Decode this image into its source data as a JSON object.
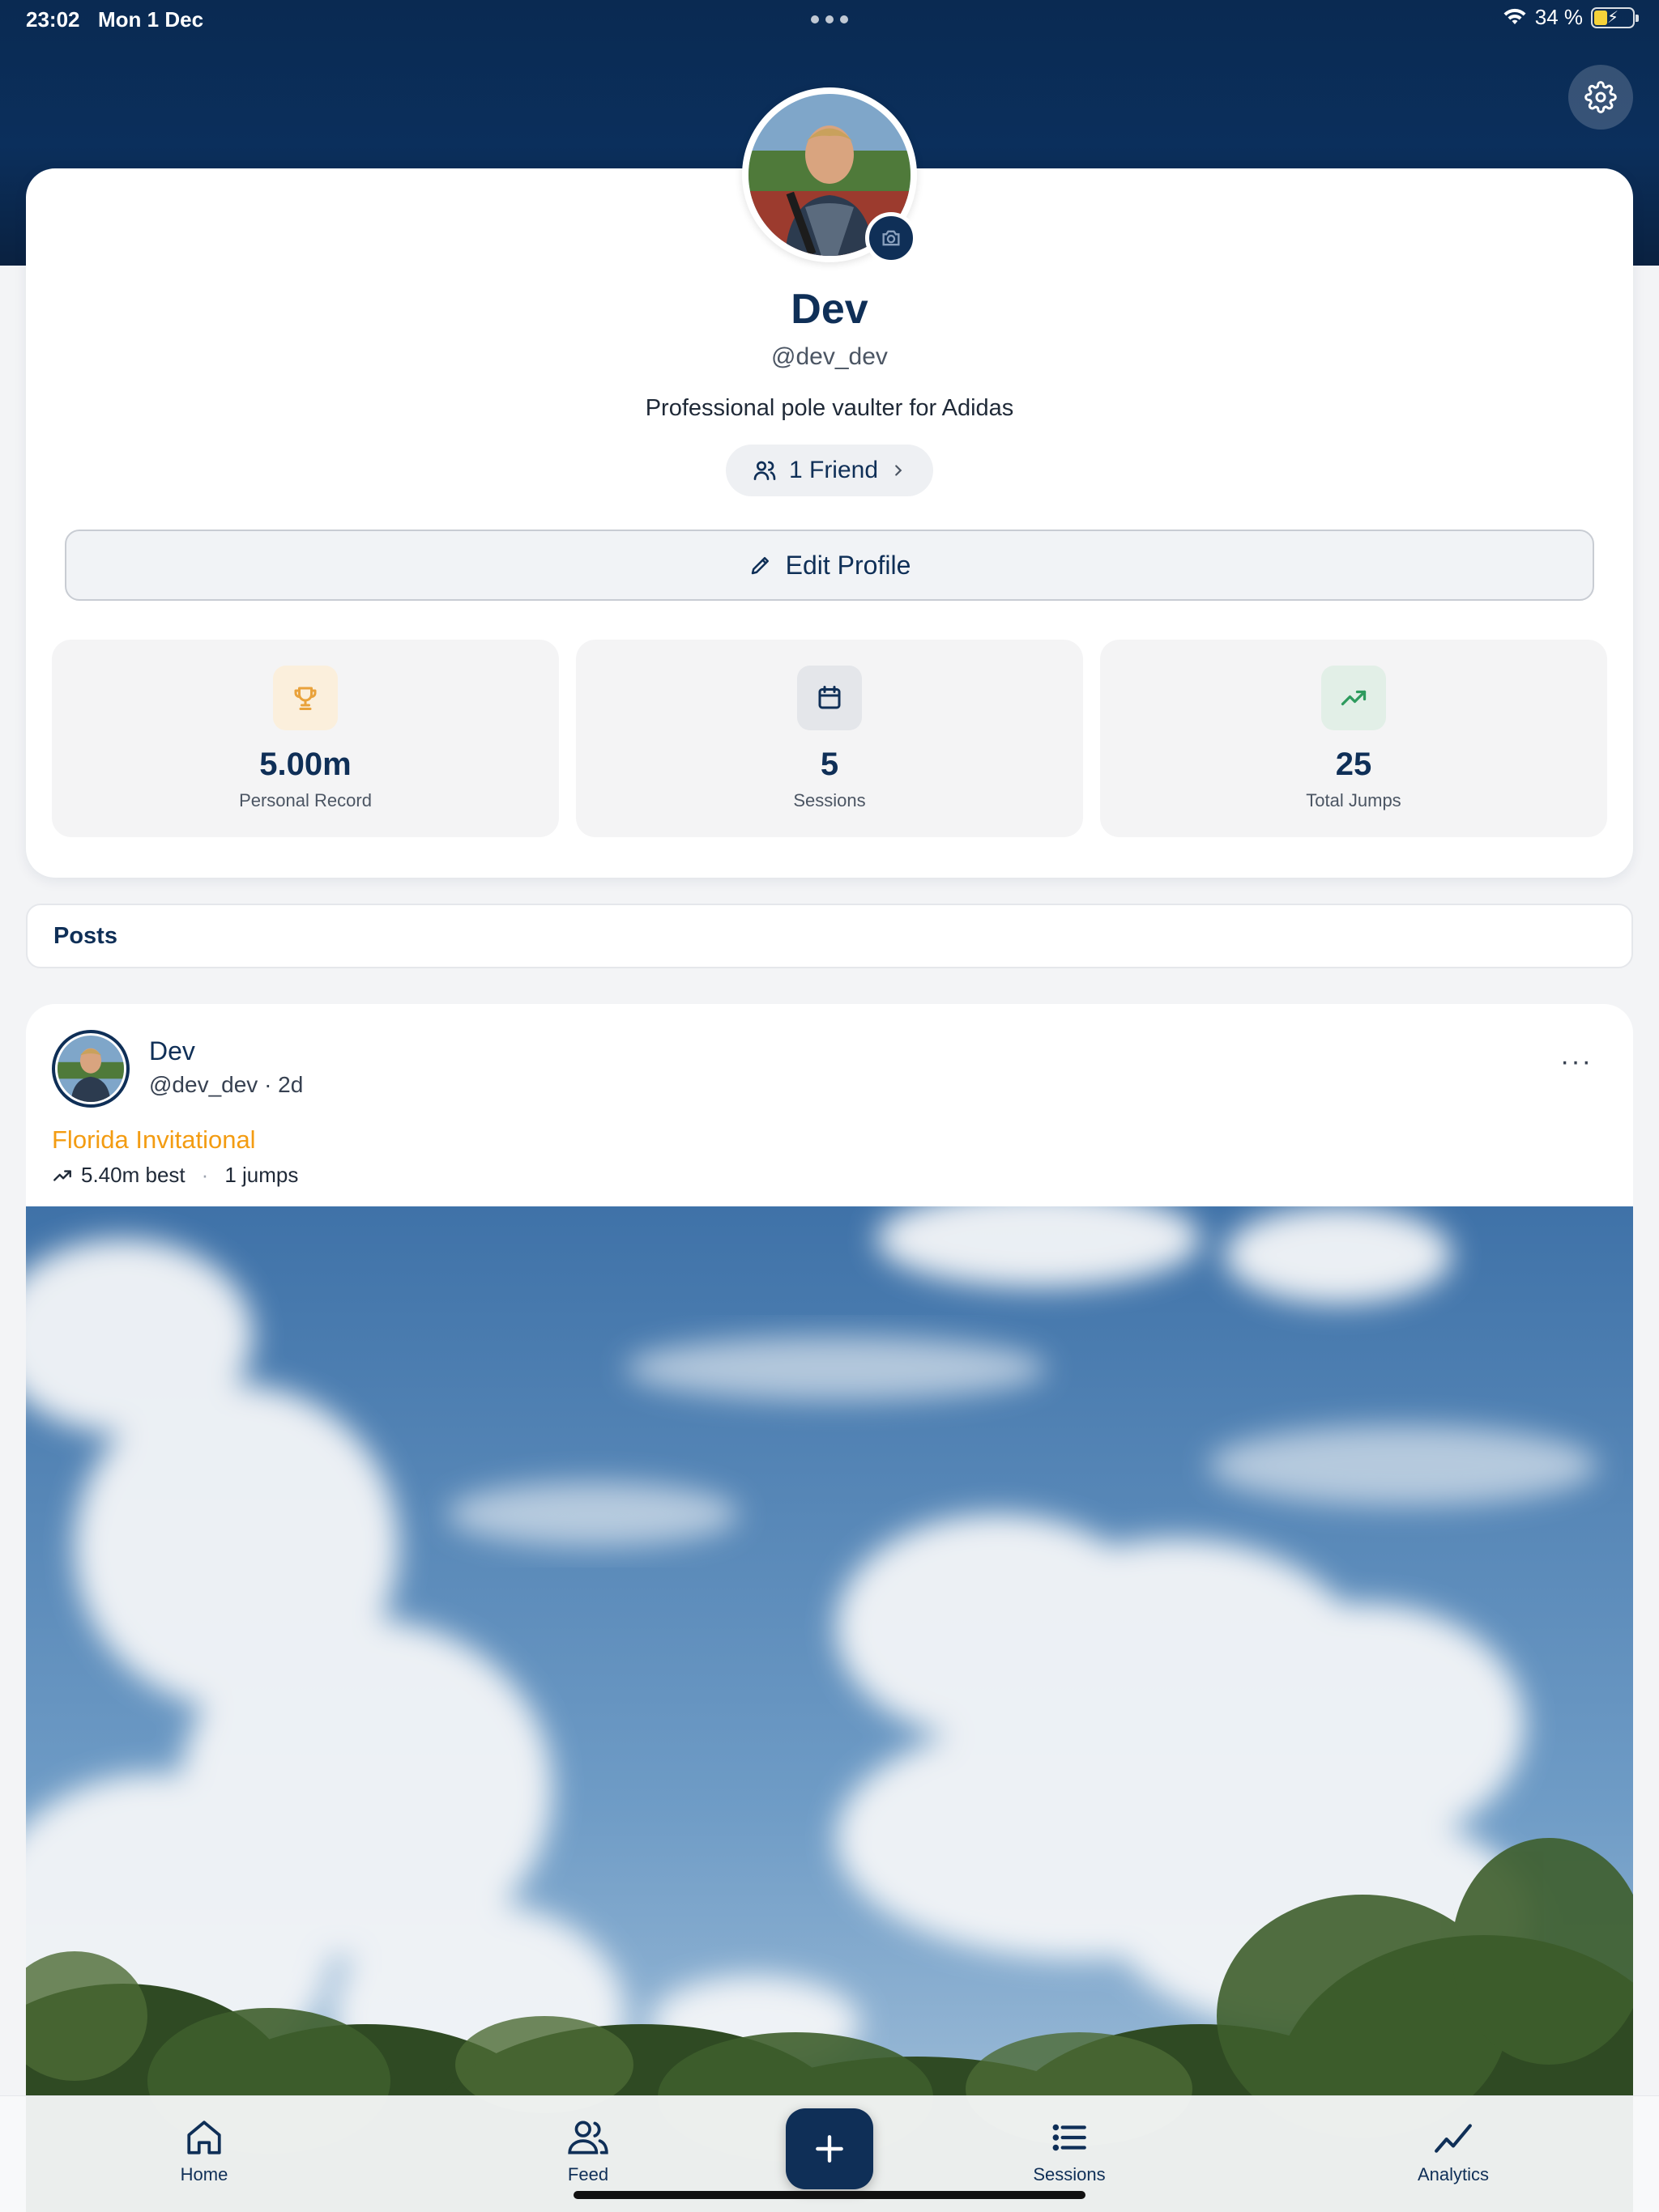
{
  "status_bar": {
    "time": "23:02",
    "date": "Mon 1 Dec",
    "battery": "34 %",
    "battery_level": 0.34
  },
  "profile": {
    "name": "Dev",
    "handle": "@dev_dev",
    "bio": "Professional pole vaulter for Adidas",
    "friends_label": "1 Friend",
    "edit_label": "Edit Profile"
  },
  "stats": [
    {
      "value": "5.00m",
      "label": "Personal Record",
      "icon": "trophy-icon",
      "color": "#e9a23b",
      "bg": "#fbefdc"
    },
    {
      "value": "5",
      "label": "Sessions",
      "icon": "calendar-icon",
      "color": "#0f2f57",
      "bg": "#e4e6ea"
    },
    {
      "value": "25",
      "label": "Total Jumps",
      "icon": "trending-up-icon",
      "color": "#2e9b5e",
      "bg": "#e2efe7"
    }
  ],
  "posts_section": {
    "title": "Posts"
  },
  "post": {
    "author": "Dev",
    "meta": "@dev_dev · 2d",
    "title": "Florida Invitational",
    "best": "5.40m best",
    "jumps": "1 jumps",
    "more": "···"
  },
  "tabs": [
    {
      "label": "Home",
      "icon": "home-icon"
    },
    {
      "label": "Feed",
      "icon": "users-icon"
    },
    {
      "label": "Sessions",
      "icon": "list-icon"
    },
    {
      "label": "Analytics",
      "icon": "analytics-icon"
    }
  ],
  "colors": {
    "brand": "#0f2f57",
    "accent": "#f39c12",
    "header_bg": "#0a2a52"
  }
}
